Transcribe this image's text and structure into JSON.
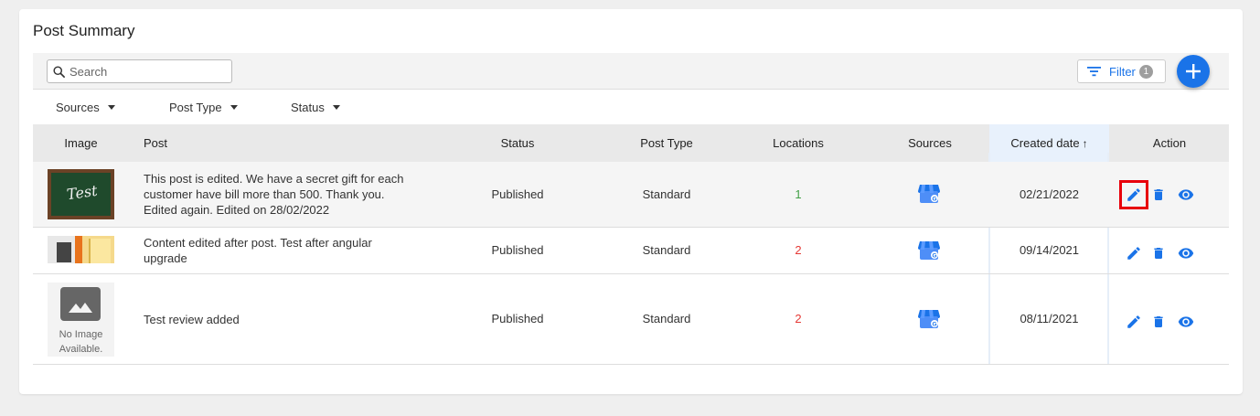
{
  "page": {
    "title": "Post Summary"
  },
  "toolbar": {
    "search_placeholder": "Search",
    "filter_label": "Filter",
    "filter_count": "1"
  },
  "filters": {
    "sources": "Sources",
    "post_type": "Post Type",
    "status": "Status"
  },
  "table": {
    "headers": {
      "image": "Image",
      "post": "Post",
      "status": "Status",
      "post_type": "Post Type",
      "locations": "Locations",
      "sources": "Sources",
      "created_date": "Created date",
      "action": "Action"
    },
    "sort_arrow": "↑",
    "rows": [
      {
        "image_text": "Test",
        "post_line1": "This post is edited. We have a secret gift for each",
        "post_line2": "customer have bill more than 500. Thank you.",
        "post_line3": "Edited again. Edited on 28/02/2022",
        "status": "Published",
        "post_type": "Standard",
        "locations": "1",
        "created_date": "02/21/2022"
      },
      {
        "post_line1": "Content edited after post. Test after angular",
        "post_line2": "upgrade",
        "status": "Published",
        "post_type": "Standard",
        "locations": "2",
        "created_date": "09/14/2021"
      },
      {
        "no_image_line1": "No Image",
        "no_image_line2": "Available.",
        "post_line1": "Test review added",
        "status": "Published",
        "post_type": "Standard",
        "locations": "2",
        "created_date": "08/11/2021"
      }
    ]
  },
  "colors": {
    "accent": "#1a73e8",
    "location_green": "#43a047",
    "location_red": "#e53935",
    "highlight_border": "#e8000b"
  }
}
